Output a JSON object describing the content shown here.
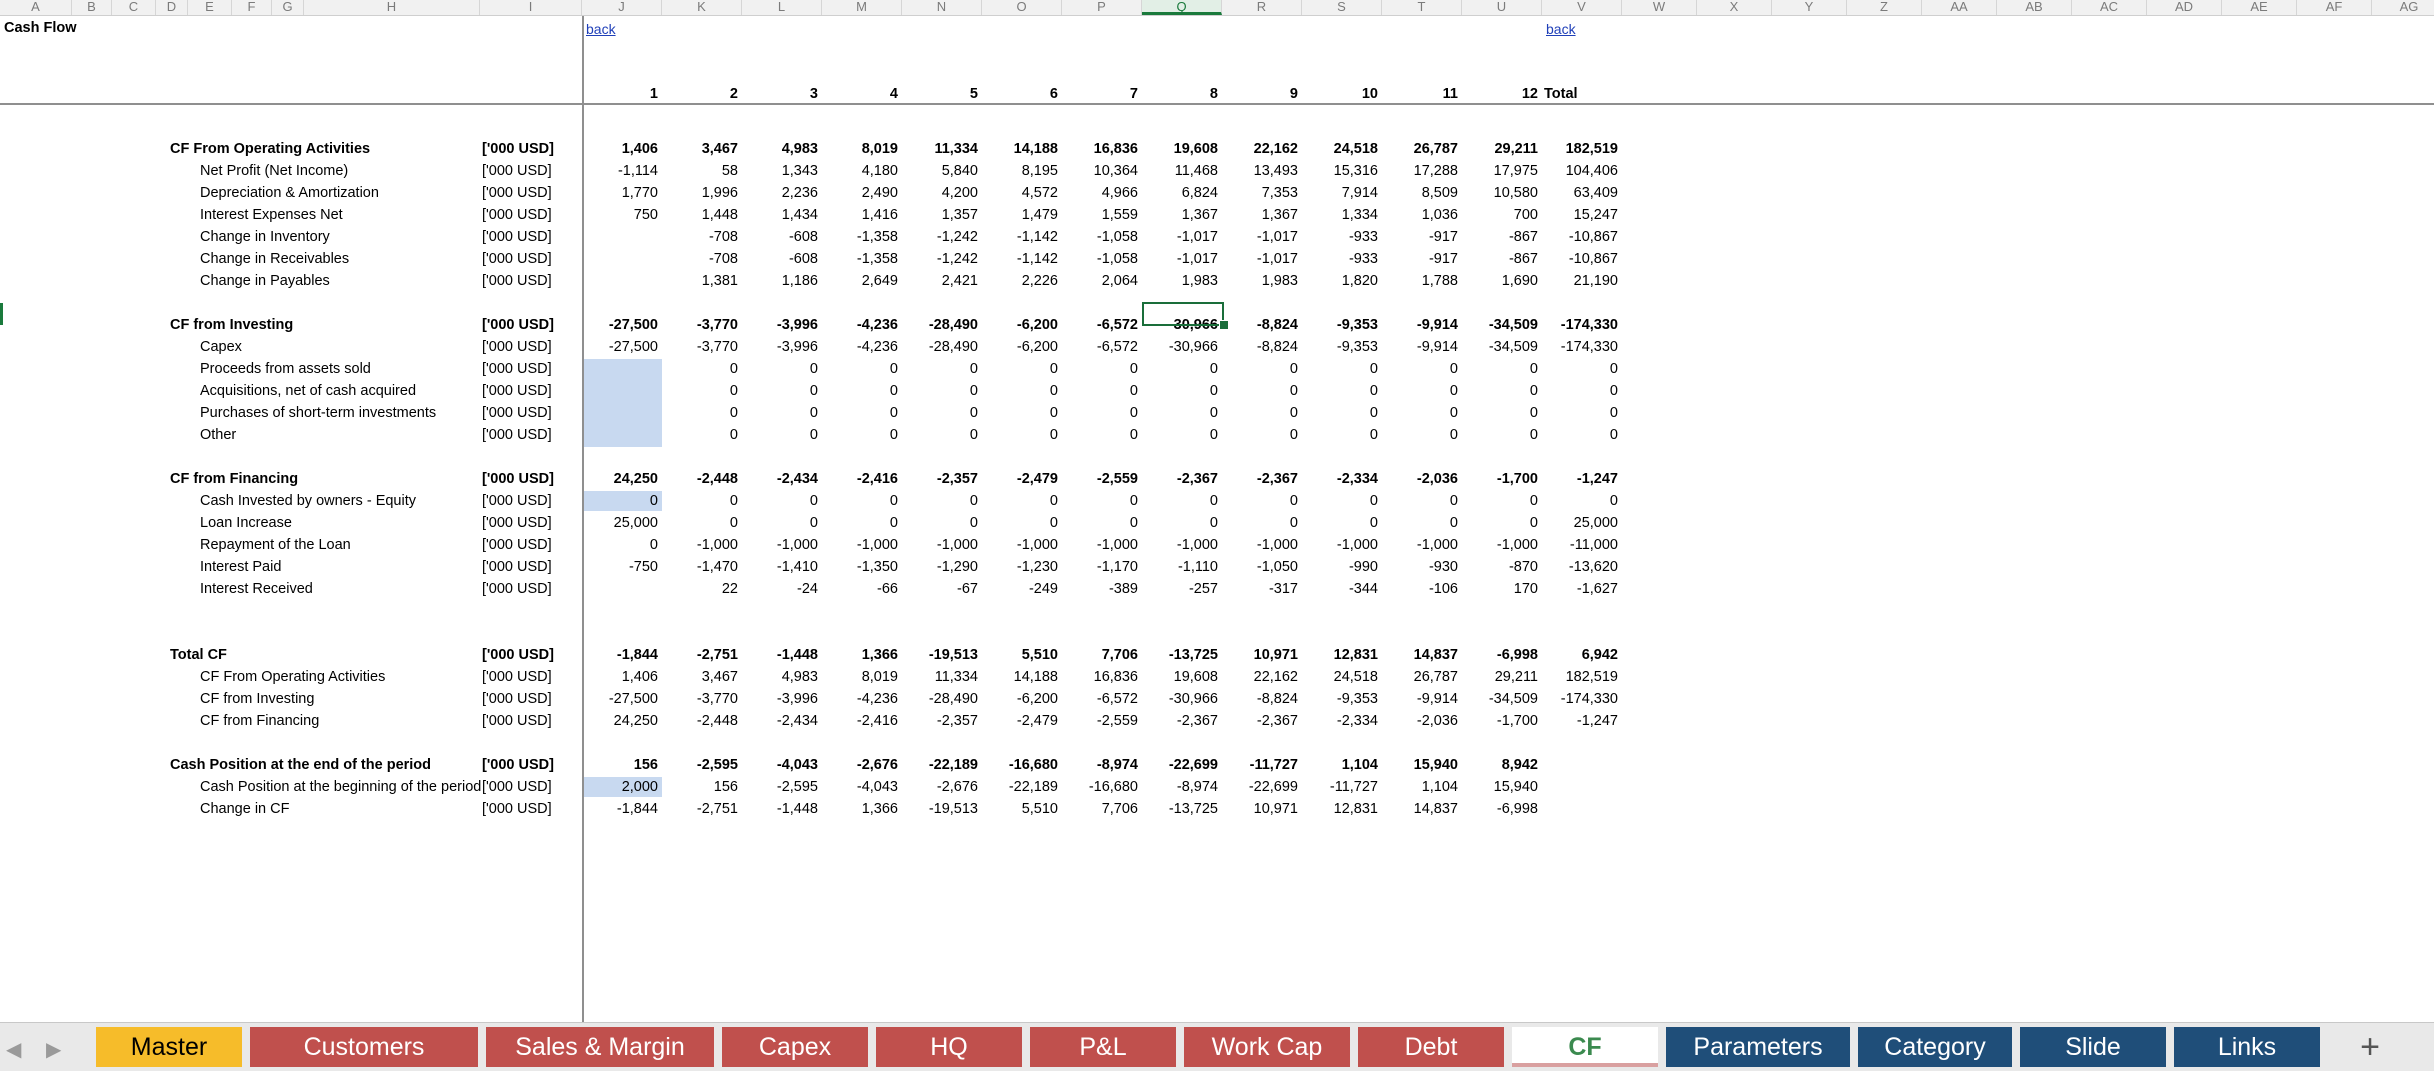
{
  "columns": [
    "A",
    "B",
    "C",
    "D",
    "E",
    "F",
    "G",
    "H",
    "I",
    "J",
    "K",
    "L",
    "M",
    "N",
    "O",
    "P",
    "Q",
    "R",
    "S",
    "T",
    "U",
    "V",
    "W",
    "X",
    "Y",
    "Z",
    "AA",
    "AB",
    "AC",
    "AD",
    "AE",
    "AF",
    "AG"
  ],
  "selected_column": "Q",
  "sheet": {
    "title": "Cash Flow",
    "back_link_1": "back",
    "back_link_2": "back",
    "periods": [
      "1",
      "2",
      "3",
      "4",
      "5",
      "6",
      "7",
      "8",
      "9",
      "10",
      "11",
      "12"
    ],
    "total_label": "Total"
  },
  "rows": [
    {
      "label": "CF From Operating Activities",
      "unit": "['000 USD]",
      "bold": true,
      "indent": false,
      "values": [
        "1,406",
        "3,467",
        "4,983",
        "8,019",
        "11,334",
        "14,188",
        "16,836",
        "19,608",
        "22,162",
        "24,518",
        "26,787",
        "29,211",
        "182,519"
      ]
    },
    {
      "label": "Net Profit (Net Income)",
      "unit": "['000 USD]",
      "bold": false,
      "indent": true,
      "values": [
        "-1,114",
        "58",
        "1,343",
        "4,180",
        "5,840",
        "8,195",
        "10,364",
        "11,468",
        "13,493",
        "15,316",
        "17,288",
        "17,975",
        "104,406"
      ]
    },
    {
      "label": "Depreciation & Amortization",
      "unit": "['000 USD]",
      "bold": false,
      "indent": true,
      "values": [
        "1,770",
        "1,996",
        "2,236",
        "2,490",
        "4,200",
        "4,572",
        "4,966",
        "6,824",
        "7,353",
        "7,914",
        "8,509",
        "10,580",
        "63,409"
      ]
    },
    {
      "label": "Interest Expenses Net",
      "unit": "['000 USD]",
      "bold": false,
      "indent": true,
      "values": [
        "750",
        "1,448",
        "1,434",
        "1,416",
        "1,357",
        "1,479",
        "1,559",
        "1,367",
        "1,367",
        "1,334",
        "1,036",
        "700",
        "15,247"
      ]
    },
    {
      "label": "Change in Inventory",
      "unit": "['000 USD]",
      "bold": false,
      "indent": true,
      "values": [
        "",
        "-708",
        "-608",
        "-1,358",
        "-1,242",
        "-1,142",
        "-1,058",
        "-1,017",
        "-1,017",
        "-933",
        "-917",
        "-867",
        "-10,867"
      ]
    },
    {
      "label": "Change in Receivables",
      "unit": "['000 USD]",
      "bold": false,
      "indent": true,
      "values": [
        "",
        "-708",
        "-608",
        "-1,358",
        "-1,242",
        "-1,142",
        "-1,058",
        "-1,017",
        "-1,017",
        "-933",
        "-917",
        "-867",
        "-10,867"
      ]
    },
    {
      "label": "Change in Payables",
      "unit": "['000 USD]",
      "bold": false,
      "indent": true,
      "values": [
        "",
        "1,381",
        "1,186",
        "2,649",
        "2,421",
        "2,226",
        "2,064",
        "1,983",
        "1,983",
        "1,820",
        "1,788",
        "1,690",
        "21,190"
      ]
    },
    null,
    {
      "label": "CF from Investing",
      "unit": "['000 USD]",
      "bold": true,
      "indent": false,
      "values": [
        "-27,500",
        "-3,770",
        "-3,996",
        "-4,236",
        "-28,490",
        "-6,200",
        "-6,572",
        "-30,966",
        "-8,824",
        "-9,353",
        "-9,914",
        "-34,509",
        "-174,330"
      ]
    },
    {
      "label": "Capex",
      "unit": "['000 USD]",
      "bold": false,
      "indent": true,
      "values": [
        "-27,500",
        "-3,770",
        "-3,996",
        "-4,236",
        "-28,490",
        "-6,200",
        "-6,572",
        "-30,966",
        "-8,824",
        "-9,353",
        "-9,914",
        "-34,509",
        "-174,330"
      ]
    },
    {
      "label": "Proceeds from assets sold",
      "unit": "['000 USD]",
      "bold": false,
      "indent": true,
      "values": [
        "",
        "0",
        "0",
        "0",
        "0",
        "0",
        "0",
        "0",
        "0",
        "0",
        "0",
        "0",
        "0"
      ]
    },
    {
      "label": "Acquisitions, net of cash acquired",
      "unit": "['000 USD]",
      "bold": false,
      "indent": true,
      "values": [
        "",
        "0",
        "0",
        "0",
        "0",
        "0",
        "0",
        "0",
        "0",
        "0",
        "0",
        "0",
        "0"
      ]
    },
    {
      "label": "Purchases of short-term investments",
      "unit": "['000 USD]",
      "bold": false,
      "indent": true,
      "values": [
        "",
        "0",
        "0",
        "0",
        "0",
        "0",
        "0",
        "0",
        "0",
        "0",
        "0",
        "0",
        "0"
      ]
    },
    {
      "label": "Other",
      "unit": "['000 USD]",
      "bold": false,
      "indent": true,
      "values": [
        "",
        "0",
        "0",
        "0",
        "0",
        "0",
        "0",
        "0",
        "0",
        "0",
        "0",
        "0",
        "0"
      ]
    },
    null,
    {
      "label": "CF from Financing",
      "unit": "['000 USD]",
      "bold": true,
      "indent": false,
      "values": [
        "24,250",
        "-2,448",
        "-2,434",
        "-2,416",
        "-2,357",
        "-2,479",
        "-2,559",
        "-2,367",
        "-2,367",
        "-2,334",
        "-2,036",
        "-1,700",
        "-1,247"
      ]
    },
    {
      "label": "Cash Invested by owners - Equity",
      "unit": "['000 USD]",
      "bold": false,
      "indent": true,
      "values": [
        "0",
        "0",
        "0",
        "0",
        "0",
        "0",
        "0",
        "0",
        "0",
        "0",
        "0",
        "0",
        "0"
      ]
    },
    {
      "label": "Loan Increase",
      "unit": "['000 USD]",
      "bold": false,
      "indent": true,
      "values": [
        "25,000",
        "0",
        "0",
        "0",
        "0",
        "0",
        "0",
        "0",
        "0",
        "0",
        "0",
        "0",
        "25,000"
      ]
    },
    {
      "label": "Repayment of the Loan",
      "unit": "['000 USD]",
      "bold": false,
      "indent": true,
      "values": [
        "0",
        "-1,000",
        "-1,000",
        "-1,000",
        "-1,000",
        "-1,000",
        "-1,000",
        "-1,000",
        "-1,000",
        "-1,000",
        "-1,000",
        "-1,000",
        "-11,000"
      ]
    },
    {
      "label": "Interest Paid",
      "unit": "['000 USD]",
      "bold": false,
      "indent": true,
      "values": [
        "-750",
        "-1,470",
        "-1,410",
        "-1,350",
        "-1,290",
        "-1,230",
        "-1,170",
        "-1,110",
        "-1,050",
        "-990",
        "-930",
        "-870",
        "-13,620"
      ]
    },
    {
      "label": "Interest Received",
      "unit": "['000 USD]",
      "bold": false,
      "indent": true,
      "values": [
        "",
        "22",
        "-24",
        "-66",
        "-67",
        "-249",
        "-389",
        "-257",
        "-317",
        "-344",
        "-106",
        "170",
        "-1,627"
      ]
    },
    null,
    null,
    {
      "label": "Total CF",
      "unit": "['000 USD]",
      "bold": true,
      "indent": false,
      "values": [
        "-1,844",
        "-2,751",
        "-1,448",
        "1,366",
        "-19,513",
        "5,510",
        "7,706",
        "-13,725",
        "10,971",
        "12,831",
        "14,837",
        "-6,998",
        "6,942"
      ]
    },
    {
      "label": "CF From Operating Activities",
      "unit": "['000 USD]",
      "bold": false,
      "indent": true,
      "values": [
        "1,406",
        "3,467",
        "4,983",
        "8,019",
        "11,334",
        "14,188",
        "16,836",
        "19,608",
        "22,162",
        "24,518",
        "26,787",
        "29,211",
        "182,519"
      ]
    },
    {
      "label": "CF from Investing",
      "unit": "['000 USD]",
      "bold": false,
      "indent": true,
      "values": [
        "-27,500",
        "-3,770",
        "-3,996",
        "-4,236",
        "-28,490",
        "-6,200",
        "-6,572",
        "-30,966",
        "-8,824",
        "-9,353",
        "-9,914",
        "-34,509",
        "-174,330"
      ]
    },
    {
      "label": "CF from Financing",
      "unit": "['000 USD]",
      "bold": false,
      "indent": true,
      "values": [
        "24,250",
        "-2,448",
        "-2,434",
        "-2,416",
        "-2,357",
        "-2,479",
        "-2,559",
        "-2,367",
        "-2,367",
        "-2,334",
        "-2,036",
        "-1,700",
        "-1,247"
      ]
    },
    null,
    {
      "label": "Cash Position at the end of the period",
      "unit": "['000 USD]",
      "bold": true,
      "indent": false,
      "values": [
        "156",
        "-2,595",
        "-4,043",
        "-2,676",
        "-22,189",
        "-16,680",
        "-8,974",
        "-22,699",
        "-11,727",
        "1,104",
        "15,940",
        "8,942",
        ""
      ]
    },
    {
      "label": "Cash Position at the beginning of the period",
      "unit": "['000 USD]",
      "bold": false,
      "indent": true,
      "values": [
        "2,000",
        "156",
        "-2,595",
        "-4,043",
        "-2,676",
        "-22,189",
        "-16,680",
        "-8,974",
        "-22,699",
        "-11,727",
        "1,104",
        "15,940",
        ""
      ]
    },
    {
      "label": "Change in CF",
      "unit": "['000 USD]",
      "bold": false,
      "indent": true,
      "values": [
        "-1,844",
        "-2,751",
        "-1,448",
        "1,366",
        "-19,513",
        "5,510",
        "7,706",
        "-13,725",
        "10,971",
        "12,831",
        "14,837",
        "-6,998",
        ""
      ]
    }
  ],
  "tabs": [
    {
      "label": "Master",
      "color": "#f6bc2a",
      "text_color": "#000000"
    },
    {
      "label": "Customers",
      "color": "#c0504d",
      "text_color": "#ffffff"
    },
    {
      "label": "Sales & Margin",
      "color": "#c0504d",
      "text_color": "#ffffff"
    },
    {
      "label": "Capex",
      "color": "#c0504d",
      "text_color": "#ffffff"
    },
    {
      "label": "HQ",
      "color": "#c0504d",
      "text_color": "#ffffff"
    },
    {
      "label": "P&L",
      "color": "#c0504d",
      "text_color": "#ffffff"
    },
    {
      "label": "Work Cap",
      "color": "#c0504d",
      "text_color": "#ffffff"
    },
    {
      "label": "Debt",
      "color": "#c0504d",
      "text_color": "#ffffff"
    },
    {
      "label": "CF",
      "color": "#ffffff",
      "text_color": "#3b8a4f",
      "active": true
    },
    {
      "label": "Parameters",
      "color": "#1f4e79",
      "text_color": "#ffffff"
    },
    {
      "label": "Category",
      "color": "#1f4e79",
      "text_color": "#ffffff"
    },
    {
      "label": "Slide",
      "color": "#1f4e79",
      "text_color": "#ffffff"
    },
    {
      "label": "Links",
      "color": "#1f4e79",
      "text_color": "#ffffff"
    }
  ],
  "tab_nav": {
    "prev_icon": "◀",
    "next_icon": "▶",
    "add_icon": "+"
  },
  "colors": {
    "input_highlight": "#c8d9f0",
    "active_cell_border": "#1a6e3a"
  }
}
